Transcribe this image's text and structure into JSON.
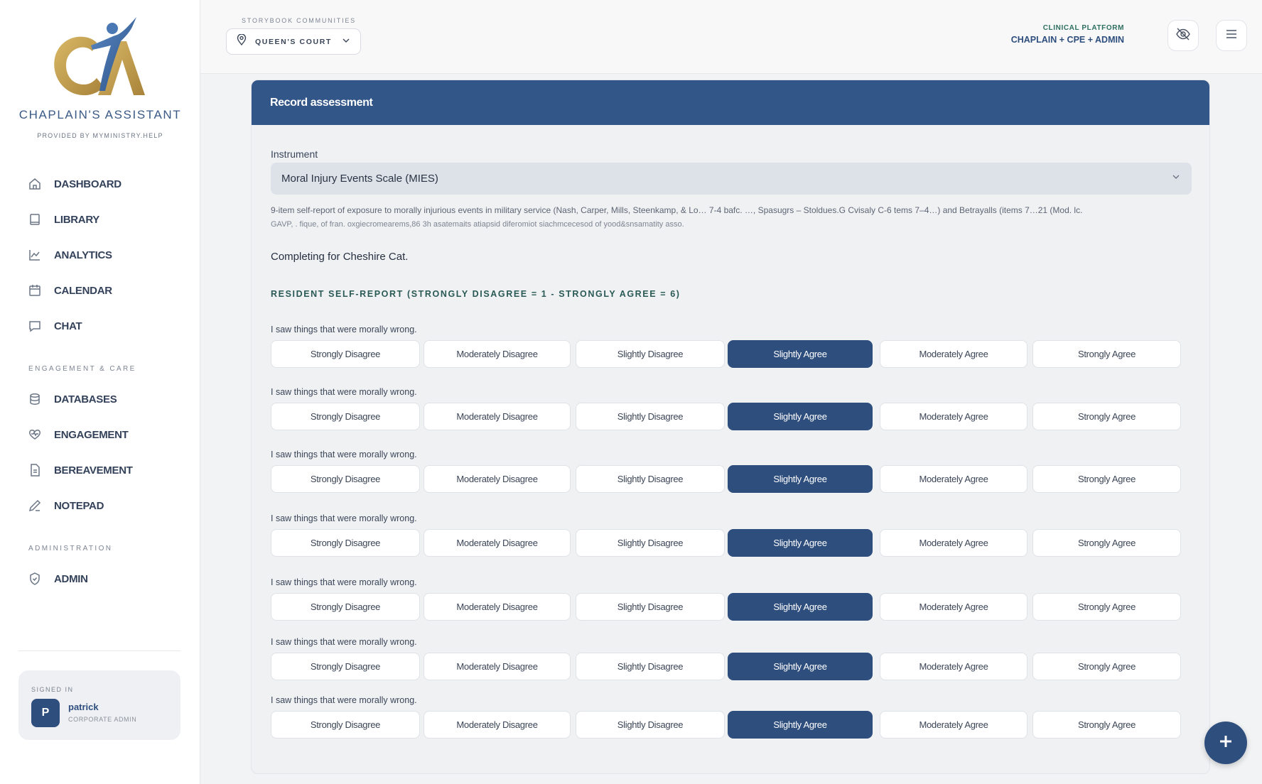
{
  "sidebar": {
    "brand": "CHAPLAIN'S ASSISTANT",
    "brand_sub": "PROVIDED BY MYMINISTRY.HELP",
    "nav": [
      {
        "label": "DASHBOARD",
        "icon": "home-icon"
      },
      {
        "label": "LIBRARY",
        "icon": "book-icon"
      },
      {
        "label": "ANALYTICS",
        "icon": "chart-icon"
      },
      {
        "label": "CALENDAR",
        "icon": "calendar-icon"
      },
      {
        "label": "CHAT",
        "icon": "chat-icon"
      }
    ],
    "section_engagement": "ENGAGEMENT & CARE",
    "engagement": [
      {
        "label": "DATABASES",
        "icon": "database-icon"
      },
      {
        "label": "ENGAGEMENT",
        "icon": "heart-icon"
      },
      {
        "label": "BEREAVEMENT",
        "icon": "document-icon"
      },
      {
        "label": "NOTEPAD",
        "icon": "pencil-icon"
      }
    ],
    "section_admin": "ADMINISTRATION",
    "admin": [
      {
        "label": "ADMIN",
        "icon": "shield-icon"
      }
    ],
    "signed_in": {
      "caption": "SIGNED IN",
      "initial": "P",
      "name": "patrick",
      "role": "CORPORATE ADMIN"
    }
  },
  "header": {
    "community_caption": "STORYBOOK COMMUNITIES",
    "community": "QUEEN'S COURT",
    "platform_line1": "CLINICAL PLATFORM",
    "platform_line2": "CHAPLAIN + CPE + ADMIN"
  },
  "card": {
    "title": "Record assessment",
    "instrument_label": "Instrument",
    "instrument_value": "Moral Injury Events Scale (MIES)",
    "description_line1": "9-item self-report of exposure to morally injurious events in military service (Nash, Carper, Mills, Steenkamp, & Lo… 7-4 bafc. …, Spasugrs – Stoldues.G Cvisaly C-6 tems 7–4…) and Betrayalls (items 7…21 (Mod. lc.",
    "description_line2": "GAVP, . fique, of fran. oxgiecromearems,86 3h asatemaits atiapsid diferomiot siachmcecesod of yood&snsamatity asso.",
    "completing": "Completing for Cheshire Cat.",
    "scale_label": "RESIDENT SELF-REPORT (STRONGLY DISAGREE = 1 - STRONGLY AGREE = 6)",
    "options": [
      "Strongly Disagree",
      "Moderately Disagree",
      "Slightly Disagree",
      "Slightly Agree",
      "Moderately Agree",
      "Strongly Agree"
    ],
    "questions": [
      {
        "text": "I saw things that were morally wrong.",
        "selected": "Slightly Agree"
      },
      {
        "text": "I saw things that were morally wrong.",
        "selected": "Slightly Agree"
      },
      {
        "text": "I saw things that were morally wrong.",
        "selected": "Slightly Agree"
      },
      {
        "text": "I saw things that were morally wrong.",
        "selected": "Slightly Agree"
      },
      {
        "text": "I saw things that were morally wrong.",
        "selected": "Slightly Agree"
      },
      {
        "text": "I saw things that were morally wrong.",
        "selected": "Slightly Agree"
      },
      {
        "text": "I saw things that were morally wrong.",
        "selected": "Slightly Agree"
      }
    ]
  },
  "colors": {
    "primary": "#2e4e7e",
    "header_bar": "#335689",
    "accent_green": "#2d6f5f",
    "logo_gold": "#c9a24a"
  }
}
